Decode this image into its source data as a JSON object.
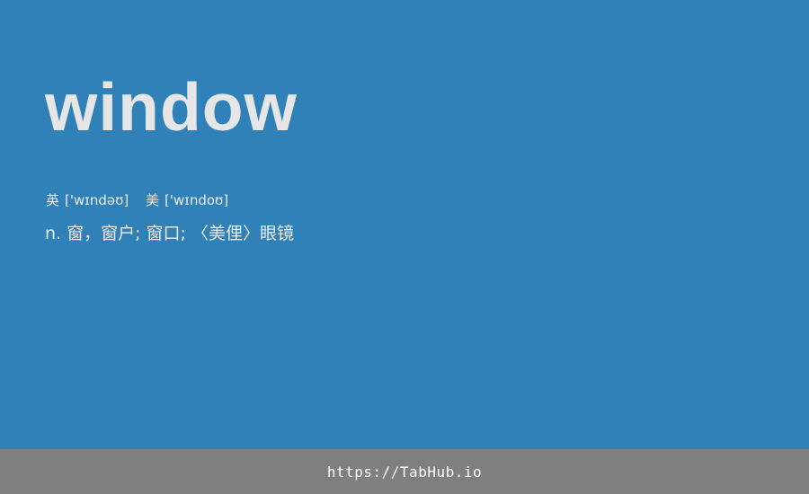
{
  "entry": {
    "word": "window",
    "phonetics": [
      {
        "region": "英",
        "ipa": "['wɪndəʊ]"
      },
      {
        "region": "美",
        "ipa": "['wɪndoʊ]"
      }
    ],
    "definition": {
      "pos": "n.",
      "text": "窗，窗户; 窗口; 〈美俚〉眼镜"
    }
  },
  "footer": {
    "link_text": "https://TabHub.io"
  },
  "colors": {
    "background": "#3081b8",
    "footer_background": "#7f7f7f",
    "text": "#e6e6e6"
  }
}
